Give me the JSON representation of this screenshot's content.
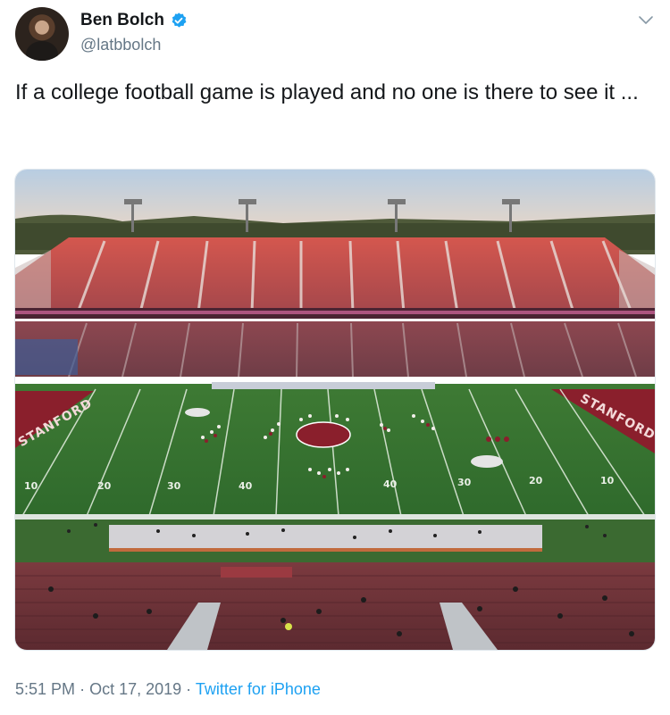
{
  "author": {
    "display_name": "Ben Bolch",
    "handle": "@latbbolch",
    "verified": true,
    "avatar_icon": "person-avatar"
  },
  "tweet": {
    "text": "If a college football game is played and no one is there to see it ..."
  },
  "media": {
    "type": "photo",
    "field_numbers": [
      "10",
      "20",
      "30",
      "40",
      "40",
      "30",
      "20",
      "10"
    ],
    "endzone_left": "STANFORD",
    "endzone_right": "STANFORD"
  },
  "meta": {
    "time": "5:51 PM",
    "separator1": "·",
    "date": "Oct 17, 2019",
    "separator2": "·",
    "source": "Twitter for iPhone"
  },
  "colors": {
    "link": "#1da1f2",
    "verified": "#1da1f2",
    "secondary_text": "#657786"
  },
  "icons": {
    "menu": "chevron-down-icon",
    "verified": "verified-badge-icon"
  }
}
